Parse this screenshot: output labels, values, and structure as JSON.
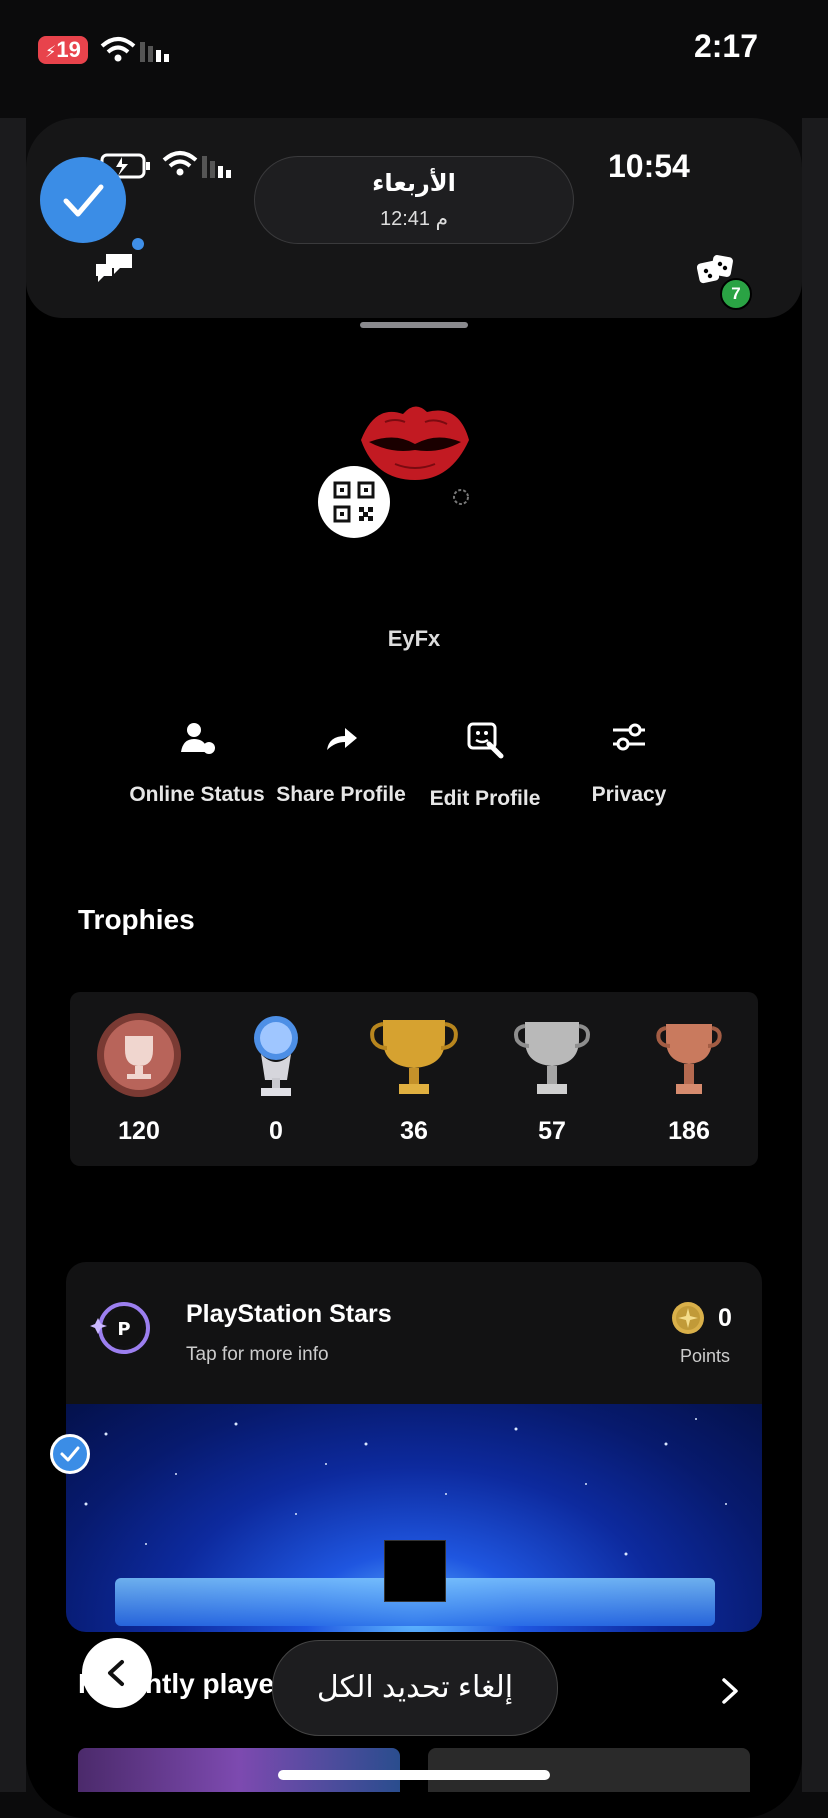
{
  "outer_status": {
    "battery": "19",
    "time": "2:17"
  },
  "inner_status": {
    "time": "10:54"
  },
  "date_pill": {
    "day": "الأربعاء",
    "time": "12:41 م"
  },
  "header": {
    "friends_badge": "7"
  },
  "profile": {
    "username": "EyFx"
  },
  "actions": [
    {
      "label": "Online Status",
      "icon": "person-status-icon"
    },
    {
      "label": "Share Profile",
      "icon": "share-arrow-icon"
    },
    {
      "label": "Edit Profile",
      "icon": "edit-profile-icon"
    },
    {
      "label": "Privacy",
      "icon": "sliders-icon"
    }
  ],
  "trophies": {
    "title": "Trophies",
    "items": [
      {
        "type": "level",
        "count": "120",
        "color": "#b8645a"
      },
      {
        "type": "platinum",
        "count": "0",
        "color": "#9fc6ff"
      },
      {
        "type": "gold",
        "count": "36",
        "color": "#d6a230"
      },
      {
        "type": "silver",
        "count": "57",
        "color": "#b9b9b9"
      },
      {
        "type": "bronze",
        "count": "186",
        "color": "#c97a5e"
      }
    ]
  },
  "stars": {
    "title": "PlayStation Stars",
    "subtitle": "Tap for more info",
    "points": "0",
    "points_label": "Points"
  },
  "recent": {
    "title": "Recently played"
  },
  "cancel_selection": "إلغاء تحديد الكل"
}
